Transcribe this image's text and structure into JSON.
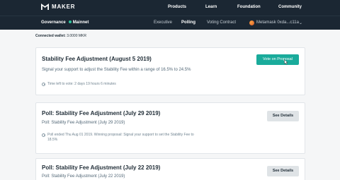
{
  "brand": {
    "name": "MAKER",
    "logo_icon": "maker-logo-icon"
  },
  "top_nav": [
    "Products",
    "Learn",
    "Foundation",
    "Community"
  ],
  "sub_nav": {
    "section": "Governance",
    "network": "Mainnet",
    "network_color": "#2fc39b",
    "tabs": [
      "Executive",
      "Polling",
      "Voting Contract"
    ],
    "active_tab": "Polling",
    "account": "Metamask 0xda...c11a"
  },
  "wallet": {
    "label": "Connected wallet:",
    "value": "3.0000 MKR"
  },
  "proposals": [
    {
      "title": "Stability Fee Adjustment (August 5 2019)",
      "subtitle": "Signal your support to adjust the Stability Fee within a range of 16.5% to 24.5%",
      "meta": "Time left to vote: 2 days 19 hours 6 minutes",
      "button": "Vote on Proposal"
    },
    {
      "title": "Poll: Stability Fee Adjustment (July 29 2019)",
      "subtitle": "Poll: Stability Fee Adjustment (July 29 2019)",
      "meta": "Poll ended Thu Aug 01 2019. Winning proposal: Signal your support to set the Stability Fee to 18.5%",
      "button": "See Details"
    },
    {
      "title": "Poll: Stability Fee Adjustment (July 22 2019)",
      "subtitle": "Poll: Stability Fee Adjustment (July 22 2019)",
      "button": "See Details"
    }
  ],
  "colors": {
    "nav_bg": "#1b2733",
    "accent": "#1aab9b",
    "page_bg": "#f5f6f7"
  }
}
